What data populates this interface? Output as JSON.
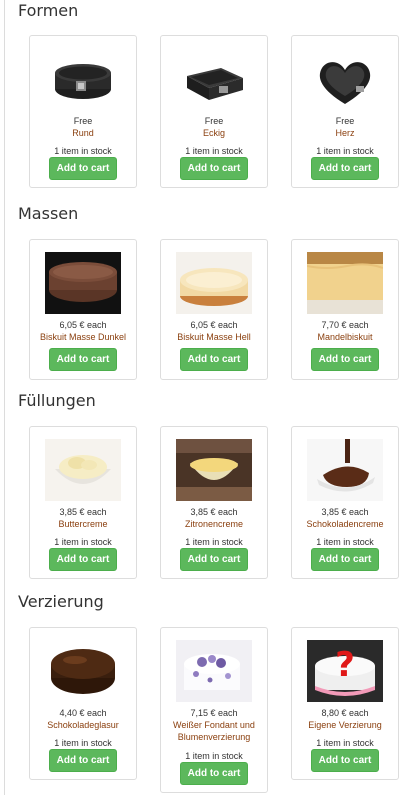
{
  "sections": [
    {
      "title": "Formen",
      "items": [
        {
          "price": "Free",
          "name": "Rund",
          "stock": "1 item in stock",
          "button": "Add to cart",
          "image_icon": "round-springform-pan-icon"
        },
        {
          "price": "Free",
          "name": "Eckig",
          "stock": "1 item in stock",
          "button": "Add to cart",
          "image_icon": "square-springform-pan-icon"
        },
        {
          "price": "Free",
          "name": "Herz",
          "stock": "1 item in stock",
          "button": "Add to cart",
          "image_icon": "heart-springform-pan-icon"
        }
      ]
    },
    {
      "title": "Massen",
      "items": [
        {
          "price": "6,05 € each",
          "name": "Biskuit Masse Dunkel",
          "stock": "",
          "button": "Add to cart",
          "image_icon": "dark-sponge-cake-icon"
        },
        {
          "price": "6,05 € each",
          "name": "Biskuit Masse Hell",
          "stock": "",
          "button": "Add to cart",
          "image_icon": "light-sponge-cake-icon"
        },
        {
          "price": "7,70 € each",
          "name": "Mandelbiskuit",
          "stock": "",
          "button": "Add to cart",
          "image_icon": "almond-sponge-cake-icon"
        }
      ]
    },
    {
      "title": "Füllungen",
      "items": [
        {
          "price": "3,85 € each",
          "name": "Buttercreme",
          "stock": "1 item in stock",
          "button": "Add to cart",
          "image_icon": "buttercream-bowl-icon"
        },
        {
          "price": "3,85 € each",
          "name": "Zitronencreme",
          "stock": "1 item in stock",
          "button": "Add to cart",
          "image_icon": "lemon-cream-bowl-icon"
        },
        {
          "price": "3,85 € each",
          "name": "Schokoladencreme",
          "stock": "1 item in stock",
          "button": "Add to cart",
          "image_icon": "chocolate-cream-icon"
        }
      ]
    },
    {
      "title": "Verzierung",
      "items": [
        {
          "price": "4,40 € each",
          "name": "Schokoladeglasur",
          "stock": "1 item in stock",
          "button": "Add to cart",
          "image_icon": "chocolate-glazed-cake-icon"
        },
        {
          "price": "7,15 € each",
          "name": "Weißer Fondant und Blumenverzierung",
          "stock": "1 item in stock",
          "button": "Add to cart",
          "image_icon": "fondant-flower-cake-icon"
        },
        {
          "price": "8,80 € each",
          "name": "Eigene Verzierung",
          "stock": "1 item in stock",
          "button": "Add to cart",
          "image_icon": "custom-decoration-cake-icon"
        }
      ]
    }
  ],
  "colors": {
    "button_bg": "#5cb85c",
    "product_name": "#8a3f0e",
    "card_border": "#dddddd"
  }
}
